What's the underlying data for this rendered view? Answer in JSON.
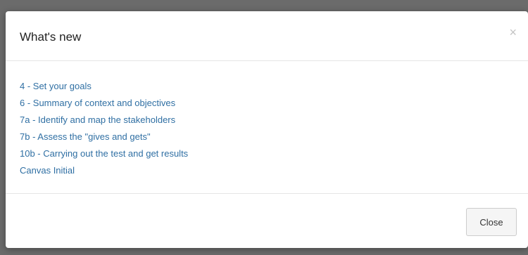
{
  "modal": {
    "title": "What's new",
    "close_icon": "×",
    "items": [
      {
        "label": "4 - Set your goals"
      },
      {
        "label": "6 - Summary of context and objectives"
      },
      {
        "label": "7a - Identify and map the stakeholders"
      },
      {
        "label": "7b - Assess the \"gives and gets\""
      },
      {
        "label": "10b - Carrying out the test and get results"
      },
      {
        "label": "Canvas Initial"
      }
    ],
    "close_button_label": "Close"
  },
  "colors": {
    "link": "#2f6fa3",
    "backdrop": "#6b6b6b",
    "title": "#222222"
  },
  "icons": {
    "close": "close-icon"
  }
}
